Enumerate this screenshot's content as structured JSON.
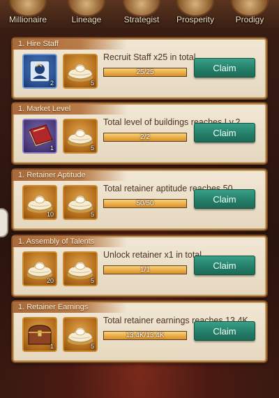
{
  "tabs": [
    {
      "label": "Millionaire",
      "icon": "money-bag-icon"
    },
    {
      "label": "Lineage",
      "icon": "flower-vase-icon"
    },
    {
      "label": "Strategist",
      "icon": "scroll-icon"
    },
    {
      "label": "Prosperity",
      "icon": "book-icon"
    },
    {
      "label": "Prodigy",
      "icon": "book-stack-icon"
    }
  ],
  "quests": [
    {
      "title": "1. Hire Staff",
      "description": "Recruit Staff x25 in total",
      "progress_text": "25/25",
      "progress": 1.0,
      "claim_label": "Claim",
      "rewards": [
        {
          "icon": "recruit-token-icon",
          "qty": "2",
          "rarity": "blue"
        },
        {
          "icon": "gold-ingot-icon",
          "qty": "5",
          "rarity": "gold"
        }
      ]
    },
    {
      "title": "1. Market Level",
      "description": "Total level of buildings reaches Lv.2",
      "progress_text": "2/2",
      "progress": 1.0,
      "claim_label": "Claim",
      "rewards": [
        {
          "icon": "red-book-icon",
          "qty": "1",
          "rarity": "purple"
        },
        {
          "icon": "gold-ingot-icon",
          "qty": "5",
          "rarity": "gold"
        }
      ]
    },
    {
      "title": "1. Retainer Aptitude",
      "description": "Total retainer aptitude reaches 50",
      "progress_text": "50/50",
      "progress": 1.0,
      "claim_label": "Claim",
      "rewards": [
        {
          "icon": "gold-ingot-icon",
          "qty": "10",
          "rarity": "gold"
        },
        {
          "icon": "gold-ingot-icon",
          "qty": "5",
          "rarity": "gold"
        }
      ]
    },
    {
      "title": "1. Assembly of Talents",
      "description": "Unlock  retainer x1 in total",
      "progress_text": "1/1",
      "progress": 1.0,
      "claim_label": "Claim",
      "rewards": [
        {
          "icon": "gold-ingot-icon",
          "qty": "20",
          "rarity": "gold"
        },
        {
          "icon": "gold-ingot-icon",
          "qty": "5",
          "rarity": "gold"
        }
      ]
    },
    {
      "title": "1. Retainer Earnings",
      "description": "Total retainer earnings reaches 13.4K",
      "progress_text": "13.4K/13.4K",
      "progress": 1.0,
      "claim_label": "Claim",
      "rewards": [
        {
          "icon": "treasure-chest-icon",
          "qty": "1",
          "rarity": "gold"
        },
        {
          "icon": "gold-ingot-icon",
          "qty": "5",
          "rarity": "gold"
        }
      ]
    }
  ]
}
